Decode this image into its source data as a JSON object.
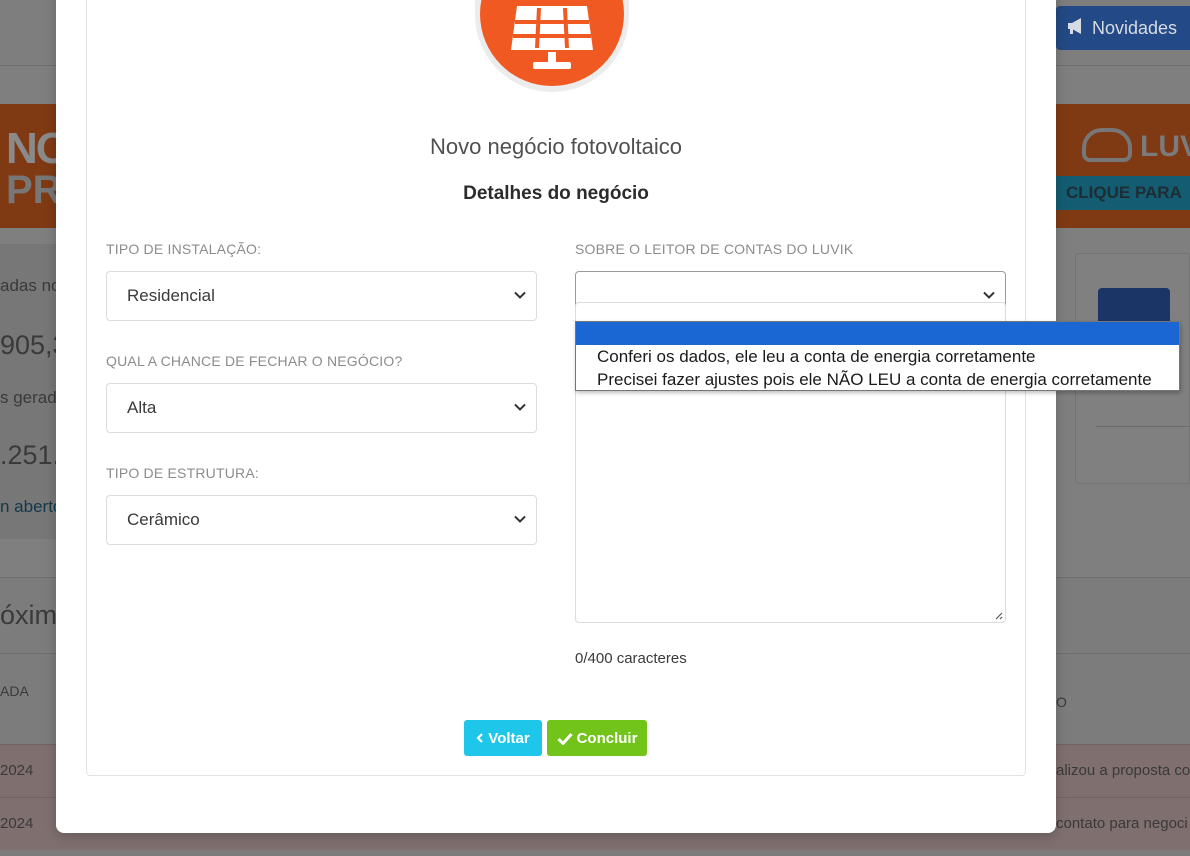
{
  "background": {
    "novidades_label": "Novidades",
    "banner_left_text_1": "NO",
    "banner_left_text_2": "PR",
    "banner_right_brand": "LUV",
    "banner_right_cta": "CLIQUE PARA",
    "stat_label_1": "adas no",
    "stat_value_1": "905,3",
    "stat_label_2": "s gerad",
    "stat_value_2": ".251.",
    "stat_link": "n aberto",
    "section_title": "óximo",
    "col_left": "ADA",
    "col_right": "O",
    "rows": [
      {
        "date": "2024",
        "status": "alizou a proposta co"
      },
      {
        "date": "2024",
        "status": "contato para negoci"
      }
    ]
  },
  "modal": {
    "title": "Novo negócio fotovoltaico",
    "subtitle": "Detalhes do negócio",
    "fields": {
      "installation": {
        "label": "TIPO DE INSTALAÇÃO:",
        "value": "Residencial"
      },
      "chance": {
        "label": "QUAL A CHANCE DE FECHAR O NEGÓCIO?",
        "value": "Alta"
      },
      "structure": {
        "label": "TIPO DE ESTRUTURA:",
        "value": "Cerâmico"
      },
      "reader": {
        "label": "SOBRE O LEITOR DE CONTAS DO LUVIK",
        "value": ""
      }
    },
    "char_count": "0/400 caracteres",
    "buttons": {
      "back": "Voltar",
      "finish": "Concluir"
    }
  },
  "dropdown": {
    "options": [
      "",
      "Conferi os dados, ele leu a conta de energia corretamente",
      "Precisei fazer ajustes pois ele NÃO LEU a conta de energia corretamente"
    ],
    "highlighted_index": 0
  },
  "colors": {
    "accent_orange": "#f05a22",
    "button_back": "#1ec6ea",
    "button_finish": "#72c41a",
    "dropdown_highlight": "#1a66d2"
  }
}
